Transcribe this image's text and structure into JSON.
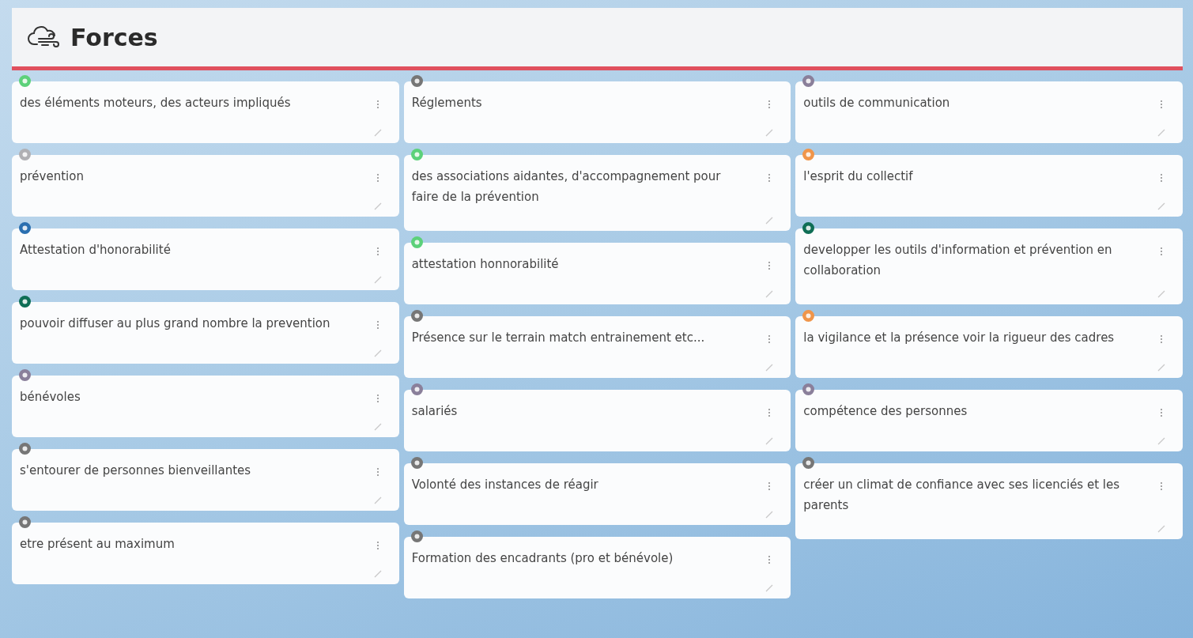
{
  "header": {
    "title": "Forces"
  },
  "columns": [
    {
      "cards": [
        {
          "text": "des éléments moteurs, des acteurs impliqués",
          "color": "#5cd17a"
        },
        {
          "text": "prévention",
          "color": "#b0b0b4"
        },
        {
          "text": "Attestation d'honorabilité",
          "color": "#2a6fb0"
        },
        {
          "text": "pouvoir diffuser au plus grand nombre la prevention",
          "color": "#0f6e55"
        },
        {
          "text": "bénévoles",
          "color": "#8a7f9a"
        },
        {
          "text": "s'entourer de personnes bienveillantes",
          "color": "#767676"
        },
        {
          "text": "etre présent au maximum",
          "color": "#767676"
        }
      ]
    },
    {
      "cards": [
        {
          "text": "Réglements",
          "color": "#767676"
        },
        {
          "text": "des associations aidantes, d'accompagnement pour faire de la prévention",
          "color": "#5cd17a"
        },
        {
          "text": "attestation honnorabilité",
          "color": "#5cd17a"
        },
        {
          "text": "Présence sur le terrain match entrainement etc...",
          "color": "#767676"
        },
        {
          "text": "salariés",
          "color": "#8a7f9a"
        },
        {
          "text": "Volonté des instances de réagir",
          "color": "#767676"
        },
        {
          "text": "Formation des encadrants (pro et bénévole)",
          "color": "#767676"
        }
      ]
    },
    {
      "cards": [
        {
          "text": "outils de communication",
          "color": "#8a7f9a"
        },
        {
          "text": "l'esprit du collectif",
          "color": "#f0954a"
        },
        {
          "text": "developper les outils d'information et prévention en collaboration",
          "color": "#0f6e55"
        },
        {
          "text": "la vigilance et la présence voir la rigueur des cadres",
          "color": "#f0954a"
        },
        {
          "text": "compétence des personnes",
          "color": "#8a7f9a"
        },
        {
          "text": "créer un climat de confiance avec ses licenciés et les parents",
          "color": "#767676"
        }
      ]
    }
  ]
}
